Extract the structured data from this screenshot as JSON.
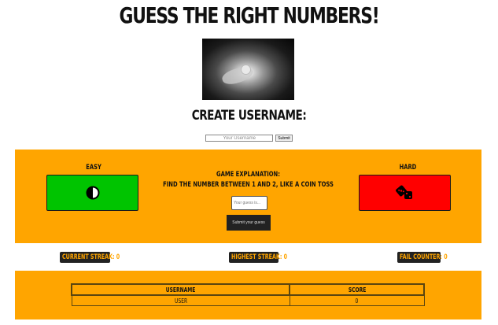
{
  "title": "Guess the Right Numbers!",
  "hero_image": {
    "icon": "hand-holding-coin-photo"
  },
  "username": {
    "heading": "Create Username:",
    "placeholder": "Your Username",
    "submit_label": "Submit"
  },
  "game": {
    "easy_label": "Easy",
    "hard_label": "Hard",
    "easy_icon": "half-circle-icon",
    "hard_icon": "dice-icon",
    "easy_color": "#00c400",
    "hard_color": "#ff0000",
    "panel_color": "#ffa500",
    "explanation_title": "Game Explanation:",
    "explanation_text": "Find the number between 1 and 2, like a coin toss",
    "guess_placeholder": "Your guess is...",
    "guess_submit_label": "Submit your guess"
  },
  "stats": {
    "current_streak": "Current streak: 0",
    "highest_streak": "Highest streak: 0",
    "fail_counter": "Fail counter: 0"
  },
  "scoreboard": {
    "headers": [
      "Username",
      "Score"
    ],
    "rows": [
      [
        "User",
        "0"
      ]
    ]
  }
}
